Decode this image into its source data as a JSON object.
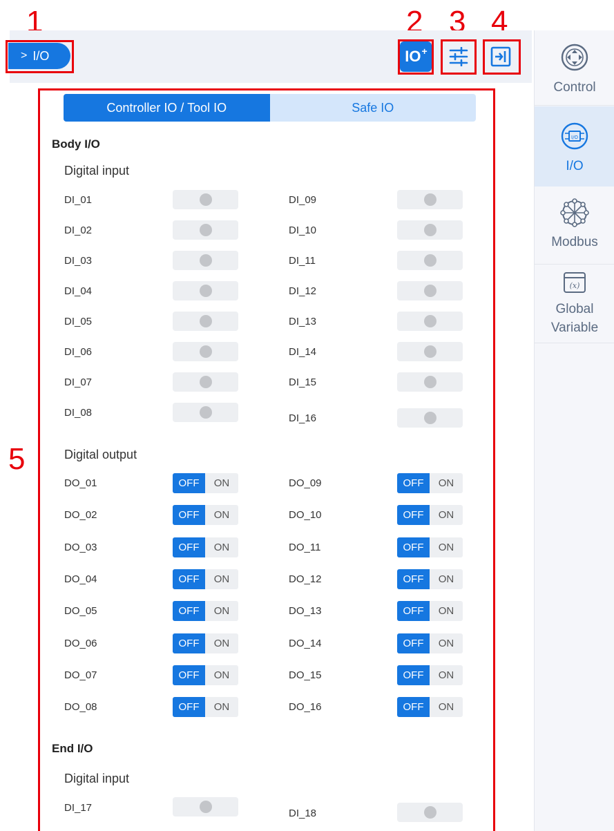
{
  "callouts": [
    "1",
    "2",
    "3",
    "4",
    "5"
  ],
  "breadcrumb": {
    "chevron": ">",
    "label": "I/O"
  },
  "header_buttons": {
    "io_add_label": "IO",
    "io_add_sup": "+",
    "settings_icon": "sliders-icon",
    "exit_icon": "panel-exit-icon"
  },
  "sidebar": {
    "items": [
      {
        "label": "Control",
        "icon": "control-pad-icon"
      },
      {
        "label": "I/O",
        "icon": "io-chip-icon",
        "active": true
      },
      {
        "label": "Modbus",
        "icon": "modbus-network-icon"
      },
      {
        "label": "Global Variable",
        "icon": "variable-x-icon"
      }
    ]
  },
  "tabs": [
    "Controller IO / Tool IO",
    "Safe IO"
  ],
  "body_io": {
    "title": "Body I/O",
    "digital_input_title": "Digital input",
    "digital_inputs": [
      "DI_01",
      "DI_02",
      "DI_03",
      "DI_04",
      "DI_05",
      "DI_06",
      "DI_07",
      "DI_08",
      "DI_09",
      "DI_10",
      "DI_11",
      "DI_12",
      "DI_13",
      "DI_14",
      "DI_15",
      "DI_16"
    ],
    "digital_output_title": "Digital output",
    "digital_outputs": [
      "DO_01",
      "DO_02",
      "DO_03",
      "DO_04",
      "DO_05",
      "DO_06",
      "DO_07",
      "DO_08",
      "DO_09",
      "DO_10",
      "DO_11",
      "DO_12",
      "DO_13",
      "DO_14",
      "DO_15",
      "DO_16"
    ],
    "toggle_off": "OFF",
    "toggle_on": "ON"
  },
  "end_io": {
    "title": "End I/O",
    "digital_input_title": "Digital input",
    "digital_inputs": [
      "DI_17",
      "DI_18"
    ]
  },
  "colors": {
    "accent": "#1677e0",
    "callout": "#e8000b",
    "inactive_dot": "#c3c5c9",
    "tab_bg": "#d4e6fb"
  }
}
